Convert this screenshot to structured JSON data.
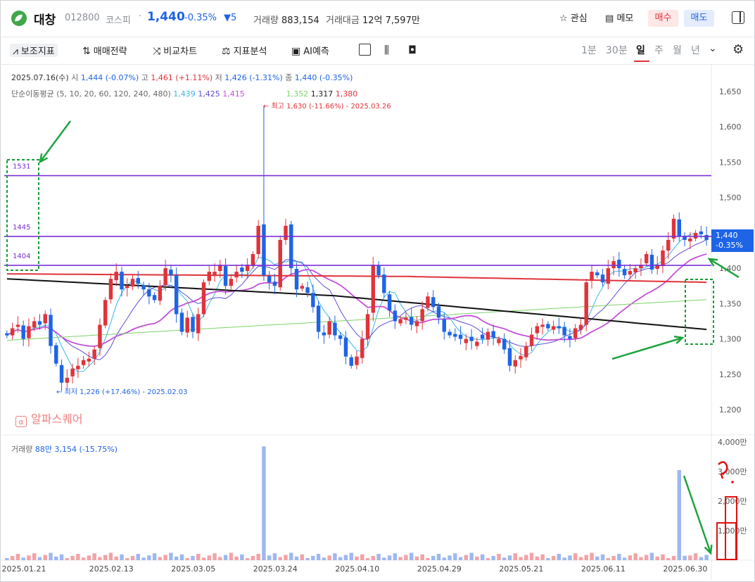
{
  "header": {
    "name": "대창",
    "code": "012800",
    "market": "코스피",
    "price": "1,440",
    "change_pct": "-0.35%",
    "change_abs": "▼5",
    "volume_label": "거래량",
    "volume": "883,154",
    "amount_label": "거래대금",
    "amount": "12억 7,597만",
    "watch_label": "관심",
    "memo_label": "메모",
    "buy_label": "매수",
    "sell_label": "매도"
  },
  "toolbar": {
    "indicator_label": "보조지표",
    "strategy_label": "매매전략",
    "compare_label": "비교차트",
    "analysis_label": "지표분석",
    "ai_label": "AI예측",
    "periods": [
      "1분",
      "30분",
      "일",
      "주",
      "월",
      "년"
    ],
    "selected_period": "일"
  },
  "ohlc_info": {
    "date": "2025.07.16(수)",
    "open_label": "시",
    "open": "1,444 (-0.07%)",
    "high_label": "고",
    "high": "1,461 (+1.11%)",
    "low_label": "저",
    "low": "1,426 (-1.31%)",
    "close_label": "종",
    "close": "1,440 (-0.35%)"
  },
  "ma_info": {
    "label": "단순이동평균 (5, 10, 20, 60, 120, 240, 480)",
    "values": [
      "1,439",
      "1,425",
      "1,415",
      "1,352",
      "1,317",
      "1,380"
    ]
  },
  "annotations": {
    "high_label": "← 최고 1,630 (-11.66%) - 2025.03.26",
    "low_label": "← 최저 1,226 (+17.46%) - 2025.02.03",
    "line_1531": "1531",
    "line_1445": "1445",
    "line_1404": "1404"
  },
  "watermark": "알파스퀘어",
  "price_tag": {
    "price": "1,440",
    "change": "-0.35%"
  },
  "volume_info": {
    "label": "거래량",
    "value": "88만 3,154 (-15.75%)"
  },
  "y_ticks": [
    "1,650",
    "1,600",
    "1,550",
    "1,500",
    "1,450",
    "1,400",
    "1,350",
    "1,300",
    "1,250",
    "1,200"
  ],
  "vol_ticks": [
    "4,000만",
    "3,000만",
    "2,000만",
    "1,000만"
  ],
  "x_ticks": [
    "2025.01.21",
    "2025.02.13",
    "2025.03.05",
    "2025.03.24",
    "2025.04.10",
    "2025.04.29",
    "2025.05.21",
    "2025.06.11",
    "2025.06.30"
  ],
  "colors": {
    "up": "#e0333a",
    "down": "#1e64e6",
    "accent": "#7b2fd8"
  },
  "chart_data": {
    "type": "candlestick",
    "price_range": [
      1180,
      1670
    ],
    "horizontal_lines": [
      1531,
      1445,
      1404
    ],
    "closes": [
      1305,
      1315,
      1320,
      1300,
      1318,
      1325,
      1320,
      1335,
      1290,
      1265,
      1238,
      1245,
      1258,
      1262,
      1270,
      1272,
      1285,
      1320,
      1355,
      1385,
      1395,
      1370,
      1375,
      1385,
      1378,
      1370,
      1360,
      1355,
      1375,
      1400,
      1390,
      1335,
      1310,
      1330,
      1310,
      1335,
      1380,
      1395,
      1395,
      1405,
      1375,
      1385,
      1395,
      1395,
      1405,
      1420,
      1460,
      1390,
      1380,
      1375,
      1440,
      1460,
      1400,
      1370,
      1375,
      1365,
      1345,
      1310,
      1305,
      1325,
      1305,
      1300,
      1275,
      1262,
      1275,
      1300,
      1335,
      1405,
      1390,
      1365,
      1340,
      1325,
      1328,
      1330,
      1320,
      1325,
      1342,
      1360,
      1345,
      1330,
      1310,
      1305,
      1303,
      1300,
      1300,
      1297,
      1296,
      1300,
      1310,
      1302,
      1300,
      1285,
      1262,
      1270,
      1276,
      1290,
      1306,
      1318,
      1320,
      1315,
      1318,
      1315,
      1305,
      1300,
      1315,
      1320,
      1380,
      1395,
      1390,
      1380,
      1400,
      1410,
      1400,
      1390,
      1396,
      1400,
      1405,
      1420,
      1398,
      1405,
      1425,
      1440,
      1470,
      1445,
      1440,
      1442,
      1450,
      1448,
      1440
    ]
  }
}
